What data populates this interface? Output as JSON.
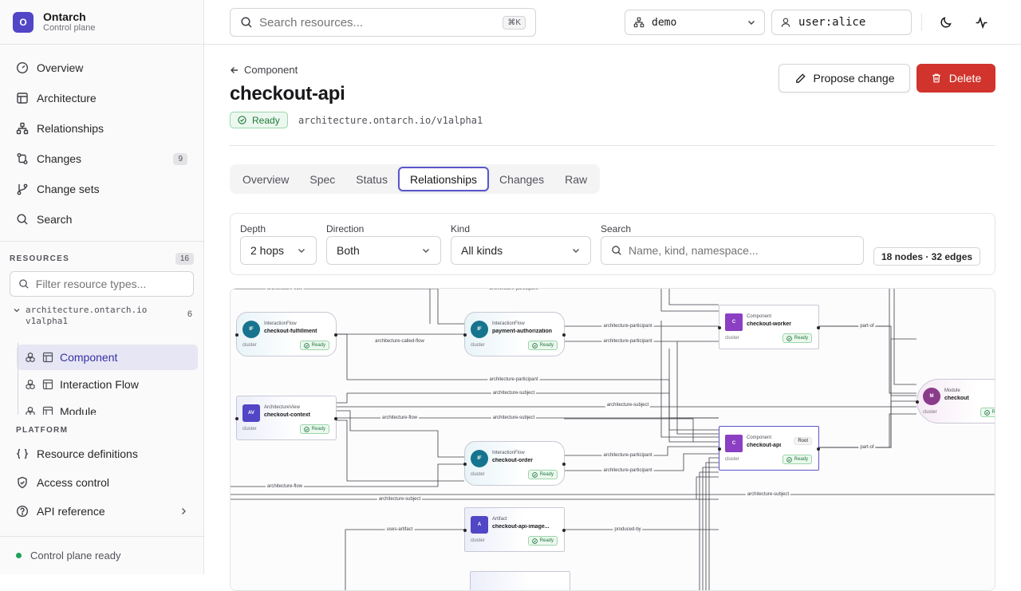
{
  "brand": {
    "logo_letter": "O",
    "name": "Ontarch",
    "subtitle": "Control plane"
  },
  "nav": [
    {
      "label": "Overview",
      "icon": "gauge-icon"
    },
    {
      "label": "Architecture",
      "icon": "layout-icon"
    },
    {
      "label": "Relationships",
      "icon": "network-icon"
    },
    {
      "label": "Changes",
      "icon": "git-compare-icon",
      "badge": "9"
    },
    {
      "label": "Change sets",
      "icon": "git-branch-icon"
    },
    {
      "label": "Search",
      "icon": "search-icon"
    }
  ],
  "resources": {
    "label": "Resources",
    "count": "16",
    "filter_placeholder": "Filter resource types...",
    "group": {
      "name": "architecture.ontarch.io",
      "version": "v1alpha1",
      "count": "6"
    },
    "items": [
      {
        "label": "Component",
        "active": true
      },
      {
        "label": "Interaction Flow",
        "active": false
      },
      {
        "label": "Module",
        "active": false
      }
    ]
  },
  "platform": {
    "label": "Platform",
    "items": [
      {
        "label": "Resource definitions"
      },
      {
        "label": "Access control"
      },
      {
        "label": "API reference"
      }
    ]
  },
  "status": {
    "text": "Control plane ready",
    "color": "#22a05a"
  },
  "topbar": {
    "search_placeholder": "Search resources...",
    "shortcut": "⌘K",
    "namespace": "demo",
    "user": "user:alice"
  },
  "page": {
    "back_label": "Component",
    "title": "checkout-api",
    "status": "Ready",
    "api_version": "architecture.ontarch.io/v1alpha1",
    "propose_label": "Propose change",
    "delete_label": "Delete"
  },
  "tabs": [
    {
      "label": "Overview"
    },
    {
      "label": "Spec"
    },
    {
      "label": "Status"
    },
    {
      "label": "Relationships",
      "active": true
    },
    {
      "label": "Changes"
    },
    {
      "label": "Raw"
    }
  ],
  "filters": {
    "depth": {
      "label": "Depth",
      "value": "2 hops"
    },
    "direction": {
      "label": "Direction",
      "value": "Both"
    },
    "kind": {
      "label": "Kind",
      "value": "All kinds"
    },
    "search": {
      "label": "Search",
      "placeholder": "Name, kind, namespace..."
    },
    "summary": "18 nodes · 32 edges"
  },
  "graph": {
    "nodes": [
      {
        "id": "fulfill",
        "shape": "flow",
        "abbr": "IF",
        "kind": "InteractionFlow",
        "name": "checkout-fulfillment",
        "scope": "cluster",
        "status": "Ready"
      },
      {
        "id": "payauth",
        "shape": "flow",
        "abbr": "IF",
        "kind": "InteractionFlow",
        "name": "payment-authorization",
        "scope": "cluster",
        "status": "Ready"
      },
      {
        "id": "worker",
        "shape": "comp",
        "abbr": "C",
        "kind": "Component",
        "name": "checkout-worker",
        "scope": "cluster",
        "status": "Ready"
      },
      {
        "id": "context",
        "shape": "view",
        "abbr": "AV",
        "kind": "ArchitectureView",
        "name": "checkout-context",
        "scope": "cluster",
        "status": "Ready"
      },
      {
        "id": "module",
        "shape": "mod",
        "abbr": "M",
        "kind": "Module",
        "name": "checkout",
        "scope": "cluster",
        "status": "Ready"
      },
      {
        "id": "order",
        "shape": "flow",
        "abbr": "IF",
        "kind": "InteractionFlow",
        "name": "checkout-order",
        "scope": "cluster",
        "status": "Ready"
      },
      {
        "id": "api",
        "shape": "comp",
        "abbr": "C",
        "kind": "Component",
        "name": "checkout-api",
        "scope": "cluster",
        "status": "Ready",
        "root": "Root"
      },
      {
        "id": "image",
        "shape": "art",
        "abbr": "A",
        "kind": "Artifact",
        "name": "checkout-api-image...",
        "scope": "cluster",
        "status": "Ready"
      }
    ],
    "edge_labels": {
      "flow": "architecture-flow",
      "participant": "architecture-participant",
      "called": "architecture-called-flow",
      "subject": "architecture-subject",
      "partof": "part-of",
      "uses": "uses-artifact",
      "produced": "produced-by"
    }
  }
}
